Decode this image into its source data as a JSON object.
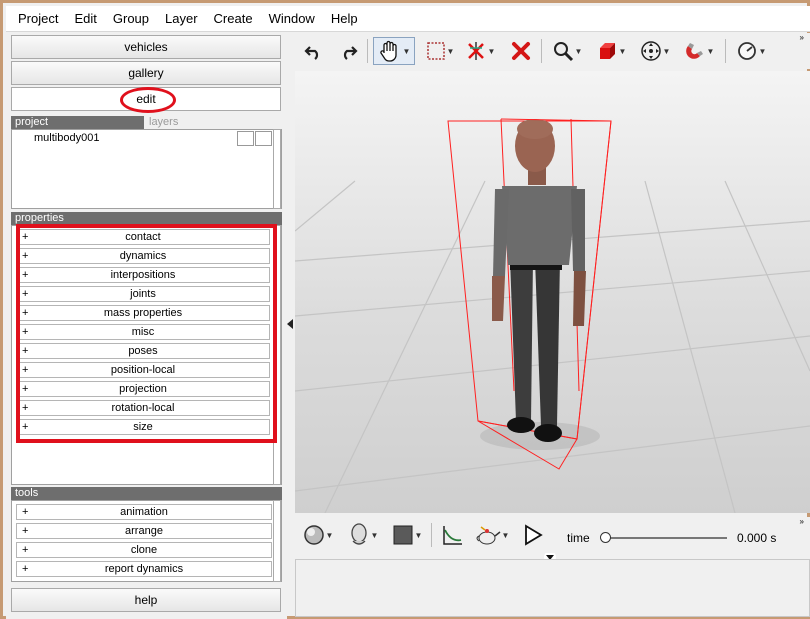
{
  "menubar": {
    "items": [
      "Project",
      "Edit",
      "Group",
      "Layer",
      "Create",
      "Window",
      "Help"
    ]
  },
  "left": {
    "nav": {
      "vehicles": "vehicles",
      "gallery": "gallery",
      "edit": "edit",
      "help": "help"
    },
    "project_panel": {
      "tab_project": "project",
      "tab_layers": "layers",
      "items": [
        "multibody001"
      ]
    },
    "properties": {
      "header": "properties",
      "items": [
        "contact",
        "dynamics",
        "interpositions",
        "joints",
        "mass properties",
        "misc",
        "poses",
        "position-local",
        "projection",
        "rotation-local",
        "size"
      ]
    },
    "tools": {
      "header": "tools",
      "items": [
        "animation",
        "arrange",
        "clone",
        "report dynamics"
      ]
    },
    "plus": "+"
  },
  "timeline": {
    "time_label": "time",
    "time_value": "0.000 s",
    "slider_position": 0
  },
  "colors": {
    "highlight_red": "#e0101c",
    "panel_header": "#6e6e6e"
  },
  "icons": [
    "undo-icon",
    "redo-icon",
    "hand-select-icon",
    "box-select-icon",
    "axis-icon",
    "delete-icon",
    "zoom-icon",
    "red-cube-icon",
    "move-icon",
    "magnet-icon",
    "dial-icon",
    "sphere-icon",
    "head-icon",
    "color-square-icon",
    "graph-icon",
    "teapot-icon",
    "play-icon"
  ]
}
